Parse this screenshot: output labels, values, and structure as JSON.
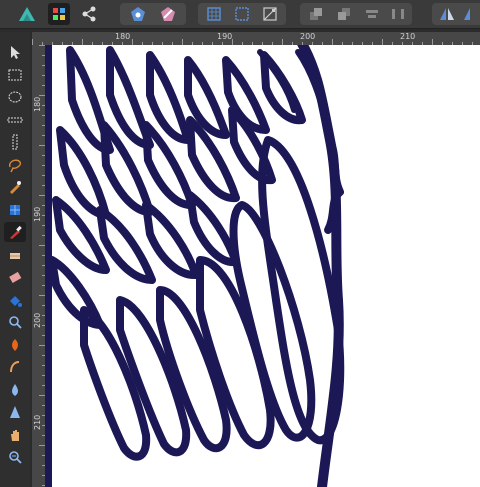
{
  "toolbar": {
    "icons": [
      "affinity-logo-icon",
      "pixel-persona-icon",
      "export-persona-icon",
      "assistant-icon",
      "boolean-icon",
      "snapping-icon",
      "grid-icon",
      "transform-icon",
      "arrange-back-icon",
      "arrange-forward-icon",
      "align-icon",
      "flip-icon"
    ]
  },
  "ruler": {
    "top_labels": [
      "180",
      "190",
      "200",
      "210"
    ],
    "left_labels": [
      "180",
      "190",
      "200",
      "210"
    ]
  },
  "tools": {
    "icons": [
      "move-tool-icon",
      "rectangle-marquee-icon",
      "ellipse-marquee-icon",
      "row-marquee-icon",
      "column-marquee-icon",
      "freehand-selection-icon",
      "selection-brush-icon",
      "flood-select-icon",
      "paint-brush-icon",
      "pixel-tool-icon",
      "erase-brush-icon",
      "fill-tool-icon",
      "zoom-tool-icon",
      "dodge-burn-icon",
      "smudge-icon",
      "blur-icon",
      "sharpen-icon",
      "hand-tool-icon",
      "view-zoom-icon"
    ],
    "active": "paint-brush-icon"
  },
  "colors": {
    "ink": "#1c1855",
    "toolbar_bg": "#3a3a3a",
    "ruler_bg": "#474747",
    "canvas_bg": "#ffffff",
    "accent": "#2a73d8"
  }
}
